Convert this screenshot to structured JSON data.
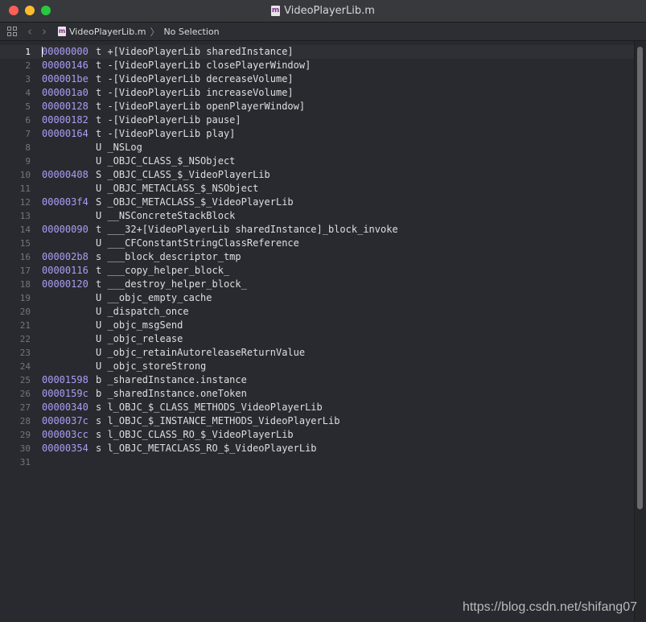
{
  "window": {
    "title": "VideoPlayerLib.m",
    "file_icon_letter": "m"
  },
  "jumpbar": {
    "file": "VideoPlayerLib.m",
    "separator": "〉",
    "selection": "No Selection",
    "back_glyph": "‹",
    "forward_glyph": "›"
  },
  "lines": [
    {
      "n": "1",
      "addr": "00000000",
      "sym": "t +[VideoPlayerLib sharedInstance]"
    },
    {
      "n": "2",
      "addr": "00000146",
      "sym": "t -[VideoPlayerLib closePlayerWindow]"
    },
    {
      "n": "3",
      "addr": "000001be",
      "sym": "t -[VideoPlayerLib decreaseVolume]"
    },
    {
      "n": "4",
      "addr": "000001a0",
      "sym": "t -[VideoPlayerLib increaseVolume]"
    },
    {
      "n": "5",
      "addr": "00000128",
      "sym": "t -[VideoPlayerLib openPlayerWindow]"
    },
    {
      "n": "6",
      "addr": "00000182",
      "sym": "t -[VideoPlayerLib pause]"
    },
    {
      "n": "7",
      "addr": "00000164",
      "sym": "t -[VideoPlayerLib play]"
    },
    {
      "n": "8",
      "addr": "",
      "sym": "U _NSLog"
    },
    {
      "n": "9",
      "addr": "",
      "sym": "U _OBJC_CLASS_$_NSObject"
    },
    {
      "n": "10",
      "addr": "00000408",
      "sym": "S _OBJC_CLASS_$_VideoPlayerLib"
    },
    {
      "n": "11",
      "addr": "",
      "sym": "U _OBJC_METACLASS_$_NSObject"
    },
    {
      "n": "12",
      "addr": "000003f4",
      "sym": "S _OBJC_METACLASS_$_VideoPlayerLib"
    },
    {
      "n": "13",
      "addr": "",
      "sym": "U __NSConcreteStackBlock"
    },
    {
      "n": "14",
      "addr": "00000090",
      "sym": "t ___32+[VideoPlayerLib sharedInstance]_block_invoke"
    },
    {
      "n": "15",
      "addr": "",
      "sym": "U ___CFConstantStringClassReference"
    },
    {
      "n": "16",
      "addr": "000002b8",
      "sym": "s ___block_descriptor_tmp"
    },
    {
      "n": "17",
      "addr": "00000116",
      "sym": "t ___copy_helper_block_"
    },
    {
      "n": "18",
      "addr": "00000120",
      "sym": "t ___destroy_helper_block_"
    },
    {
      "n": "19",
      "addr": "",
      "sym": "U __objc_empty_cache"
    },
    {
      "n": "20",
      "addr": "",
      "sym": "U _dispatch_once"
    },
    {
      "n": "21",
      "addr": "",
      "sym": "U _objc_msgSend"
    },
    {
      "n": "22",
      "addr": "",
      "sym": "U _objc_release"
    },
    {
      "n": "23",
      "addr": "",
      "sym": "U _objc_retainAutoreleaseReturnValue"
    },
    {
      "n": "24",
      "addr": "",
      "sym": "U _objc_storeStrong"
    },
    {
      "n": "25",
      "addr": "00001598",
      "sym": "b _sharedInstance.instance"
    },
    {
      "n": "26",
      "addr": "0000159c",
      "sym": "b _sharedInstance.oneToken"
    },
    {
      "n": "27",
      "addr": "00000340",
      "sym": "s l_OBJC_$_CLASS_METHODS_VideoPlayerLib"
    },
    {
      "n": "28",
      "addr": "0000037c",
      "sym": "s l_OBJC_$_INSTANCE_METHODS_VideoPlayerLib"
    },
    {
      "n": "29",
      "addr": "000003cc",
      "sym": "s l_OBJC_CLASS_RO_$_VideoPlayerLib"
    },
    {
      "n": "30",
      "addr": "00000354",
      "sym": "s l_OBJC_METACLASS_RO_$_VideoPlayerLib"
    },
    {
      "n": "31",
      "addr": "",
      "sym": ""
    }
  ],
  "watermark": "https://blog.csdn.net/shifang07",
  "colors": {
    "address": "#a79ff5",
    "text": "#dfdfe0",
    "line_number": "#747478",
    "editor_background": "#292a30"
  }
}
